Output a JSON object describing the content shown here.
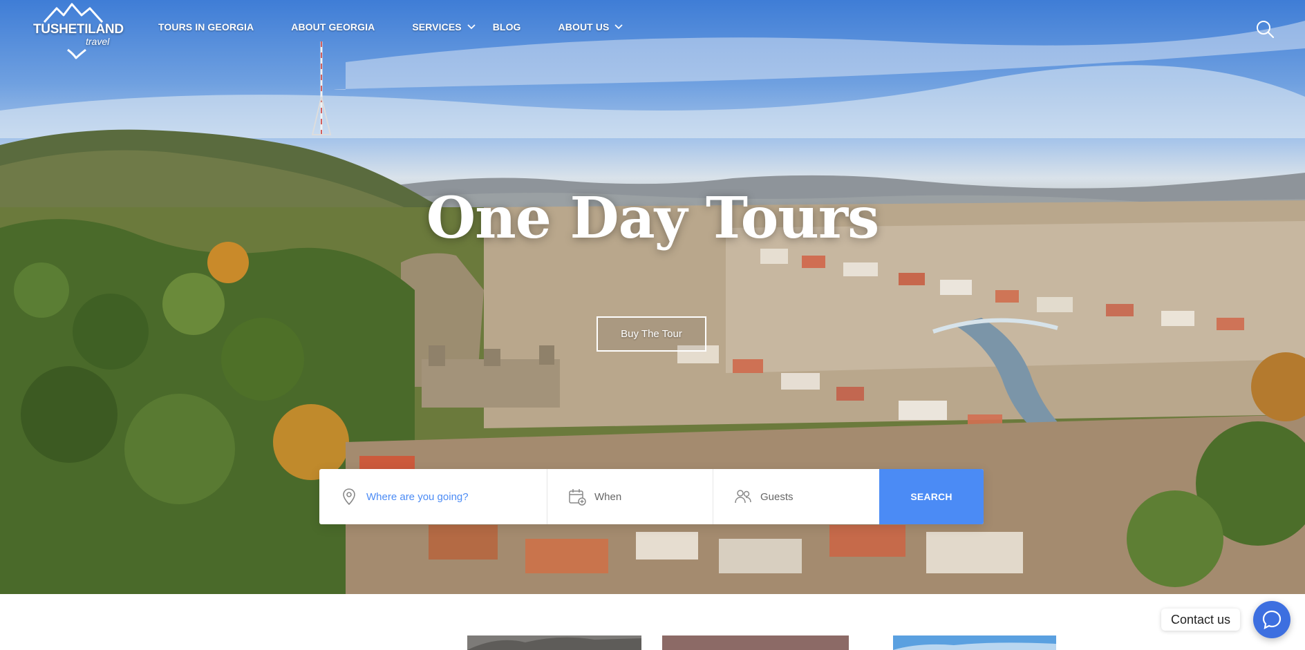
{
  "brand": {
    "logo_main": "TUSHETILAND",
    "logo_sub": "travel"
  },
  "nav": {
    "items": [
      {
        "label": "TOURS IN GEORGIA",
        "has_dropdown": false
      },
      {
        "label": "ABOUT GEORGIA",
        "has_dropdown": false
      },
      {
        "label": "SERVICES",
        "has_dropdown": true
      },
      {
        "label": "BLOG",
        "has_dropdown": false
      },
      {
        "label": "ABOUT US",
        "has_dropdown": true
      }
    ],
    "search_icon": "search-icon"
  },
  "hero": {
    "title": "One Day Tours",
    "cta_label": "Buy The Tour"
  },
  "search": {
    "where_placeholder": "Where are you going?",
    "when_placeholder": "When",
    "guests_placeholder": "Guests",
    "submit_label": "SEARCH",
    "icons": [
      "map-pin-icon",
      "calendar-add-icon",
      "users-icon"
    ]
  },
  "contact": {
    "label": "Contact us",
    "icon": "chat-bubble-icon"
  },
  "colors": {
    "accent": "#4b8bf5",
    "contact": "#3d6fe0",
    "logo_accent": "#e53935"
  }
}
